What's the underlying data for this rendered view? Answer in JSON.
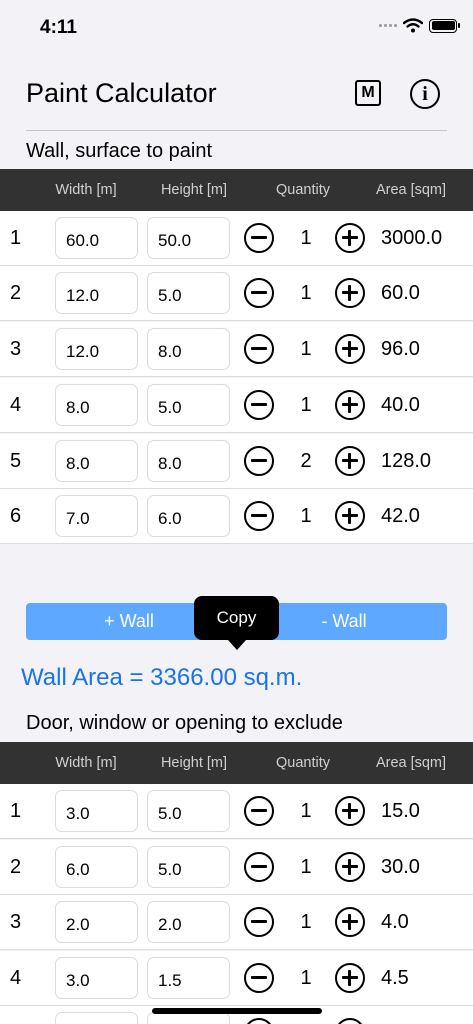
{
  "status": {
    "time": "4:11"
  },
  "app": {
    "title": "Paint Calculator",
    "m_label": "M",
    "info_label": "i"
  },
  "walls": {
    "title": "Wall, surface to paint",
    "headers": [
      "Width [m]",
      "Height [m]",
      "Quantity",
      "Area [sqm]"
    ],
    "rows": [
      {
        "index": "1",
        "width": "60.0",
        "height": "50.0",
        "quantity": "1",
        "area": "3000.0"
      },
      {
        "index": "2",
        "width": "12.0",
        "height": "5.0",
        "quantity": "1",
        "area": "60.0"
      },
      {
        "index": "3",
        "width": "12.0",
        "height": "8.0",
        "quantity": "1",
        "area": "96.0"
      },
      {
        "index": "4",
        "width": "8.0",
        "height": "5.0",
        "quantity": "1",
        "area": "40.0"
      },
      {
        "index": "5",
        "width": "8.0",
        "height": "8.0",
        "quantity": "2",
        "area": "128.0"
      },
      {
        "index": "6",
        "width": "7.0",
        "height": "6.0",
        "quantity": "1",
        "area": "42.0"
      }
    ],
    "add_label": "+ Wall",
    "remove_label": "- Wall",
    "copy_label": "Copy",
    "total_label": "Wall Area = 3366.00 sq.m."
  },
  "openings": {
    "title": "Door, window or opening to exclude",
    "headers": [
      "Width [m]",
      "Height [m]",
      "Quantity",
      "Area [sqm]"
    ],
    "rows": [
      {
        "index": "1",
        "width": "3.0",
        "height": "5.0",
        "quantity": "1",
        "area": "15.0"
      },
      {
        "index": "2",
        "width": "6.0",
        "height": "5.0",
        "quantity": "1",
        "area": "30.0"
      },
      {
        "index": "3",
        "width": "2.0",
        "height": "2.0",
        "quantity": "1",
        "area": "4.0"
      },
      {
        "index": "4",
        "width": "3.0",
        "height": "1.5",
        "quantity": "1",
        "area": "4.5"
      }
    ]
  },
  "colors": {
    "accent": "#1a73e8",
    "button_bg": "#5ea8ff",
    "header_bg": "#323232",
    "page_bg": "#f2f2f7"
  }
}
